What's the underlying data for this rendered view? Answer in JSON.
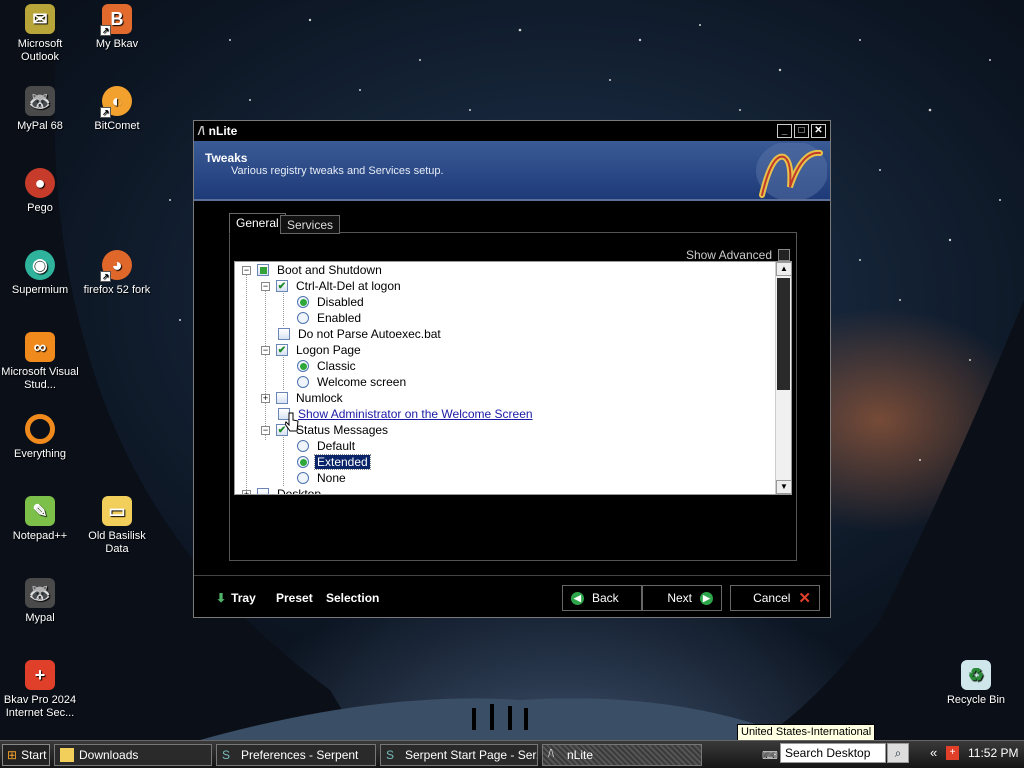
{
  "desktop": {
    "icons": [
      {
        "label": "Microsoft Outlook",
        "icon": "outlook-icon",
        "color": "#b8a53a"
      },
      {
        "label": "My Bkav",
        "icon": "bkav-icon",
        "color": "#e26a2c"
      },
      {
        "label": "MyPal 68",
        "icon": "mypal-icon",
        "color": "#d9d1b8"
      },
      {
        "label": "BitComet",
        "icon": "bitcomet-icon",
        "color": "#f2a12e"
      },
      {
        "label": "Pego",
        "icon": "pego-icon",
        "color": "#c63b2a"
      },
      {
        "label": "Supermium",
        "icon": "supermium-icon",
        "color": "#2fb39c"
      },
      {
        "label": "firefox 52 fork",
        "icon": "firefox-icon",
        "color": "#e0672a"
      },
      {
        "label": "Microsoft Visual Stud...",
        "icon": "visual-studio-icon",
        "color": "#f08a1c"
      },
      {
        "label": "Everything",
        "icon": "everything-icon",
        "color": "#f08a1c"
      },
      {
        "label": "Notepad++",
        "icon": "notepadpp-icon",
        "color": "#7cc04a"
      },
      {
        "label": "Old Basilisk Data",
        "icon": "folder-icon",
        "color": "#f2cf5b"
      },
      {
        "label": "Mypal",
        "icon": "mypal-icon",
        "color": "#d9d1b8"
      },
      {
        "label": "Bkav Pro 2024 Internet Sec...",
        "icon": "bkav-shield-icon",
        "color": "#e0402a"
      },
      {
        "label": "Recycle Bin",
        "icon": "recycle-bin-icon",
        "color": "#cfe7ea"
      }
    ]
  },
  "window": {
    "title": "nLite",
    "header_title": "Tweaks",
    "header_subtitle": "Various registry tweaks and Services setup.",
    "tabs": [
      "General",
      "Services"
    ],
    "show_advanced": "Show Advanced",
    "tree": [
      {
        "label": "Boot and Shutdown",
        "kind": "checkbox",
        "state": "partial"
      },
      {
        "label": "Ctrl-Alt-Del at logon",
        "kind": "checkbox",
        "state": "checked"
      },
      {
        "label": "Disabled",
        "kind": "radio",
        "state": "on"
      },
      {
        "label": "Enabled",
        "kind": "radio",
        "state": "off"
      },
      {
        "label": "Do not Parse Autoexec.bat",
        "kind": "checkbox",
        "state": "off"
      },
      {
        "label": "Logon Page",
        "kind": "checkbox",
        "state": "checked"
      },
      {
        "label": "Classic",
        "kind": "radio",
        "state": "on"
      },
      {
        "label": "Welcome screen",
        "kind": "radio",
        "state": "off"
      },
      {
        "label": "Numlock",
        "kind": "checkbox",
        "state": "off"
      },
      {
        "label": "Show Administrator on the Welcome Screen",
        "kind": "checkbox",
        "state": "off"
      },
      {
        "label": "Status Messages",
        "kind": "checkbox",
        "state": "checked"
      },
      {
        "label": "Default",
        "kind": "radio",
        "state": "off"
      },
      {
        "label": "Extended",
        "kind": "radio",
        "state": "on"
      },
      {
        "label": "None",
        "kind": "radio",
        "state": "off"
      },
      {
        "label": "Desktop",
        "kind": "checkbox",
        "state": "off"
      }
    ],
    "footer": {
      "tray": "Tray",
      "preset": "Preset",
      "selection": "Selection",
      "back": "Back",
      "next": "Next",
      "cancel": "Cancel"
    }
  },
  "taskbar": {
    "start": "Start",
    "items": [
      "Downloads",
      "Preferences - Serpent",
      "Serpent Start Page - Ser...",
      "nLite"
    ],
    "search_placeholder": "Search Desktop",
    "tooltip": "United States-International",
    "chevron": "«",
    "clock": "11:52 PM"
  }
}
